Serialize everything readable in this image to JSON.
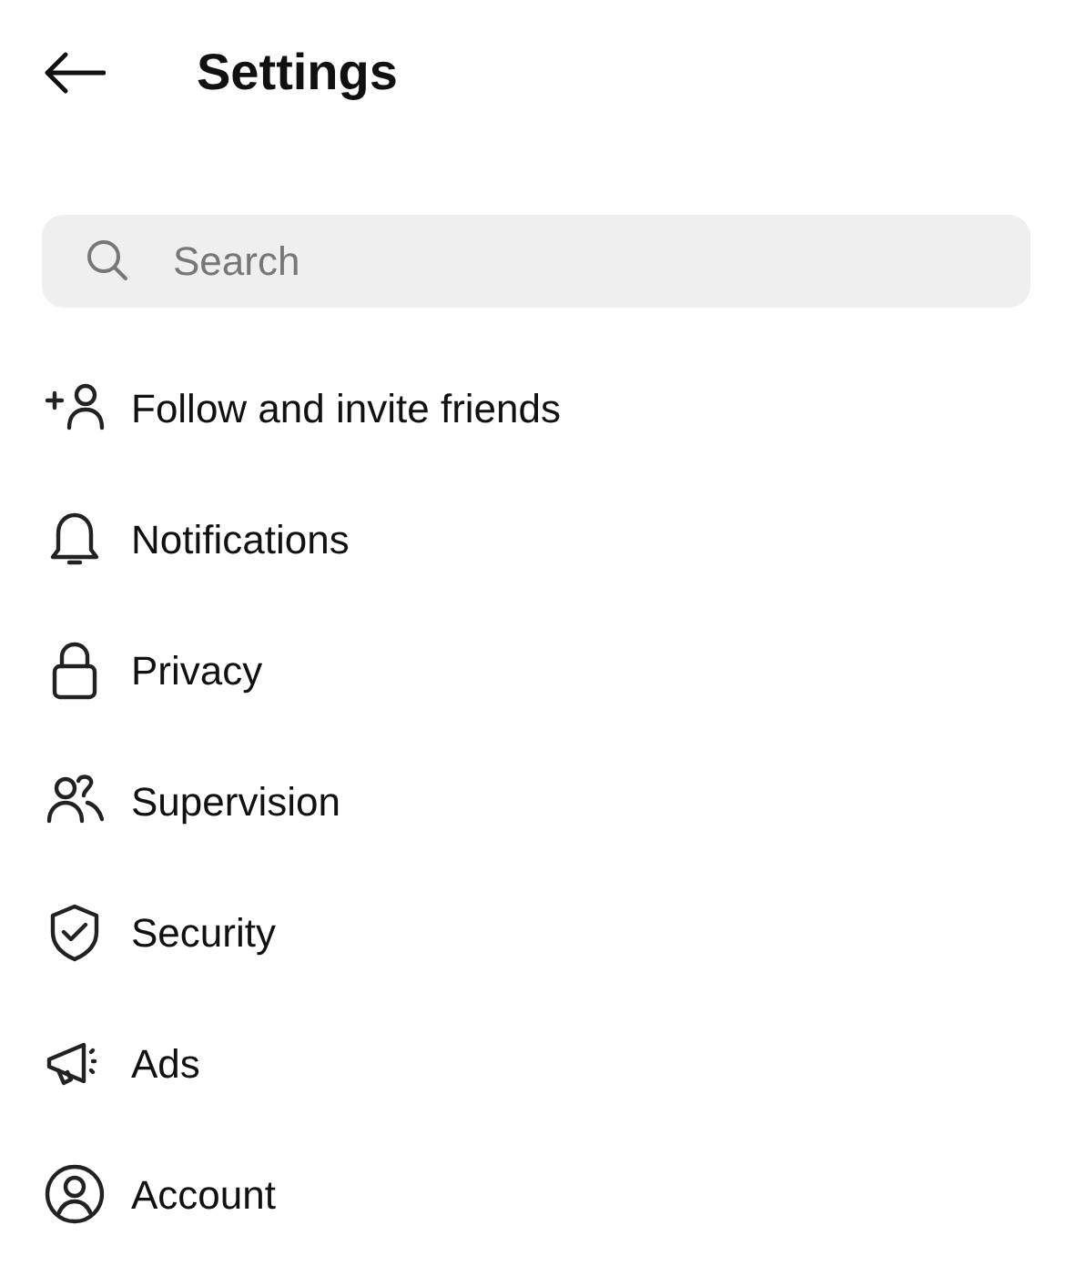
{
  "header": {
    "title": "Settings"
  },
  "search": {
    "placeholder": "Search"
  },
  "items": [
    {
      "kind": "add-person",
      "label": "Follow and invite friends"
    },
    {
      "kind": "bell",
      "label": "Notifications"
    },
    {
      "kind": "lock",
      "label": "Privacy"
    },
    {
      "kind": "people",
      "label": "Supervision"
    },
    {
      "kind": "shield",
      "label": "Security"
    },
    {
      "kind": "megaphone",
      "label": "Ads"
    },
    {
      "kind": "account",
      "label": "Account"
    }
  ]
}
